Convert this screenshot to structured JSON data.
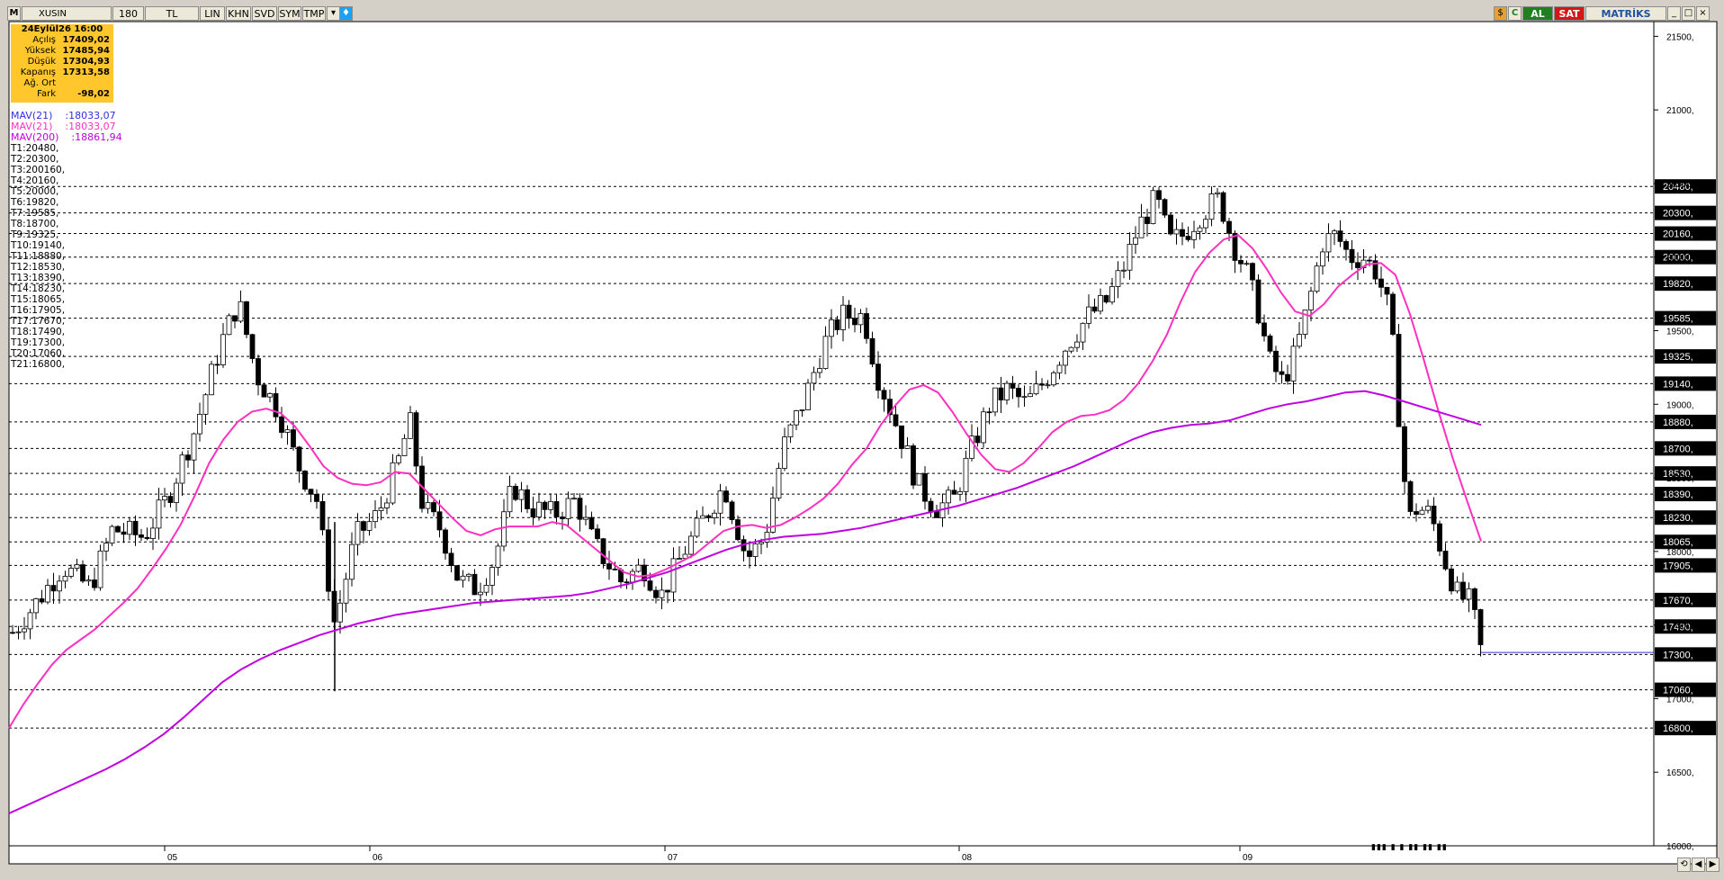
{
  "toolbar": {
    "logo": "M",
    "symbol": "XUSIN",
    "period": "180",
    "currency": "TL",
    "buttons": [
      "LIN",
      "KHN",
      "SVD",
      "SYM",
      "TMP"
    ],
    "right_c": "C",
    "buy": "AL",
    "sell": "SAT",
    "brand": "MATRİKS"
  },
  "ohlc_box": {
    "date": "24Eylül26 16:00",
    "rows": [
      {
        "label": "Açılış",
        "value": "17409,02"
      },
      {
        "label": "Yüksek",
        "value": "17485,94"
      },
      {
        "label": "Düşük",
        "value": "17304,93"
      },
      {
        "label": "Kapanış",
        "value": "17313,58"
      },
      {
        "label": "Ağ. Ort",
        "value": ""
      },
      {
        "label": "Fark",
        "value": "-98,02"
      }
    ]
  },
  "indicators": [
    {
      "name": "MAV(21)",
      "value": ":18033,07",
      "color": "#3030e0"
    },
    {
      "name": "MAV(21)",
      "value": ":18033,07",
      "color": "#ff30c0"
    },
    {
      "name": "MAV(200)",
      "value": ":18861,94",
      "color": "#c000e0"
    }
  ],
  "trend_labels": [
    "T1:20480,",
    "T2:20300,",
    "T3:200160,",
    "T4:20160,",
    "T5:20000,",
    "T6:19820,",
    "T7:19585,",
    "T8:18700,",
    "T9:19325,",
    "T10:19140,",
    "T11:18880,",
    "T12:18530,",
    "T13:18390,",
    "T14:18230,",
    "T15:18065,",
    "T16:17905,",
    "T17:17670,",
    "T18:17490,",
    "T19:17300,",
    "T20:17060,",
    "T21:16800,"
  ],
  "chart_data": {
    "type": "candlestick",
    "ylim": [
      16000,
      21600
    ],
    "y_ticks": [
      "21500,",
      "21000,",
      "20500,",
      "20000,",
      "19500,",
      "19000,",
      "18500,",
      "18000,",
      "17500,",
      "17000,",
      "16500,",
      "16000,"
    ],
    "y_tick_values": [
      21500,
      21000,
      20500,
      20000,
      19500,
      19000,
      18500,
      18000,
      17500,
      17000,
      16500,
      16000
    ],
    "x_ticks": [
      {
        "label": "05",
        "index": 16
      },
      {
        "label": "06",
        "index": 39
      },
      {
        "label": "07",
        "index": 71
      },
      {
        "label": "08",
        "index": 103
      },
      {
        "label": "09",
        "index": 133
      }
    ],
    "levels": [
      20480,
      20300,
      20160,
      20000,
      19820,
      19585,
      19325,
      19140,
      18880,
      18700,
      18530,
      18390,
      18230,
      18065,
      17905,
      17670,
      17490,
      17300,
      17060,
      16800
    ],
    "level_labels": [
      "20480,",
      "20300,",
      "20160,",
      "20000,",
      "19820,",
      "19585,",
      "19325,",
      "19140,",
      "18880,",
      "18700,",
      "18530,",
      "18390,",
      "18230,",
      "18065,",
      "17905,",
      "17670,",
      "17490,",
      "17300,",
      "17060,",
      "16800,"
    ],
    "ma_short": {
      "name": "MAV(21)",
      "color": "#ff30c0",
      "from_index": 0,
      "values": [
        16800,
        16960,
        17100,
        17230,
        17330,
        17400,
        17470,
        17560,
        17650,
        17750,
        17880,
        18020,
        18180,
        18380,
        18600,
        18760,
        18880,
        18950,
        18970,
        18940,
        18850,
        18720,
        18580,
        18500,
        18460,
        18450,
        18470,
        18540,
        18530,
        18430,
        18330,
        18230,
        18140,
        18110,
        18150,
        18170,
        18170,
        18170,
        18200,
        18180,
        18100,
        18020,
        17940,
        17860,
        17830,
        17840,
        17880,
        17930,
        17980,
        18060,
        18140,
        18170,
        18180,
        18160,
        18180,
        18230,
        18290,
        18360,
        18460,
        18590,
        18700,
        18860,
        18990,
        19100,
        19130,
        19080,
        18950,
        18800,
        18660,
        18560,
        18540,
        18600,
        18700,
        18810,
        18880,
        18920,
        18930,
        18960,
        19030,
        19140,
        19290,
        19470,
        19700,
        19900,
        20030,
        20120,
        20150,
        20060,
        19920,
        19760,
        19630,
        19600,
        19680,
        19800,
        19880,
        19950,
        19960,
        19880,
        19620,
        19300,
        18960,
        18640,
        18350,
        18070
      ]
    },
    "ma_long": {
      "name": "MAV(200)",
      "color": "#c000e0",
      "from_index": 0,
      "values": [
        16220,
        16280,
        16340,
        16400,
        16460,
        16520,
        16590,
        16670,
        16760,
        16870,
        16990,
        17110,
        17200,
        17270,
        17330,
        17380,
        17430,
        17470,
        17510,
        17540,
        17570,
        17590,
        17610,
        17630,
        17650,
        17660,
        17670,
        17680,
        17690,
        17700,
        17720,
        17750,
        17780,
        17820,
        17860,
        17910,
        17960,
        18010,
        18050,
        18080,
        18100,
        18110,
        18120,
        18140,
        18160,
        18190,
        18220,
        18250,
        18280,
        18310,
        18350,
        18390,
        18430,
        18480,
        18530,
        18580,
        18640,
        18700,
        18760,
        18810,
        18840,
        18860,
        18870,
        18890,
        18930,
        18970,
        19000,
        19020,
        19050,
        19080,
        19090,
        19060,
        19020,
        18980,
        18940,
        18900,
        18860
      ]
    }
  },
  "status_marks": "▮▮▮ ▮ ▮ ▮▮ ▮▮ ▮▮"
}
